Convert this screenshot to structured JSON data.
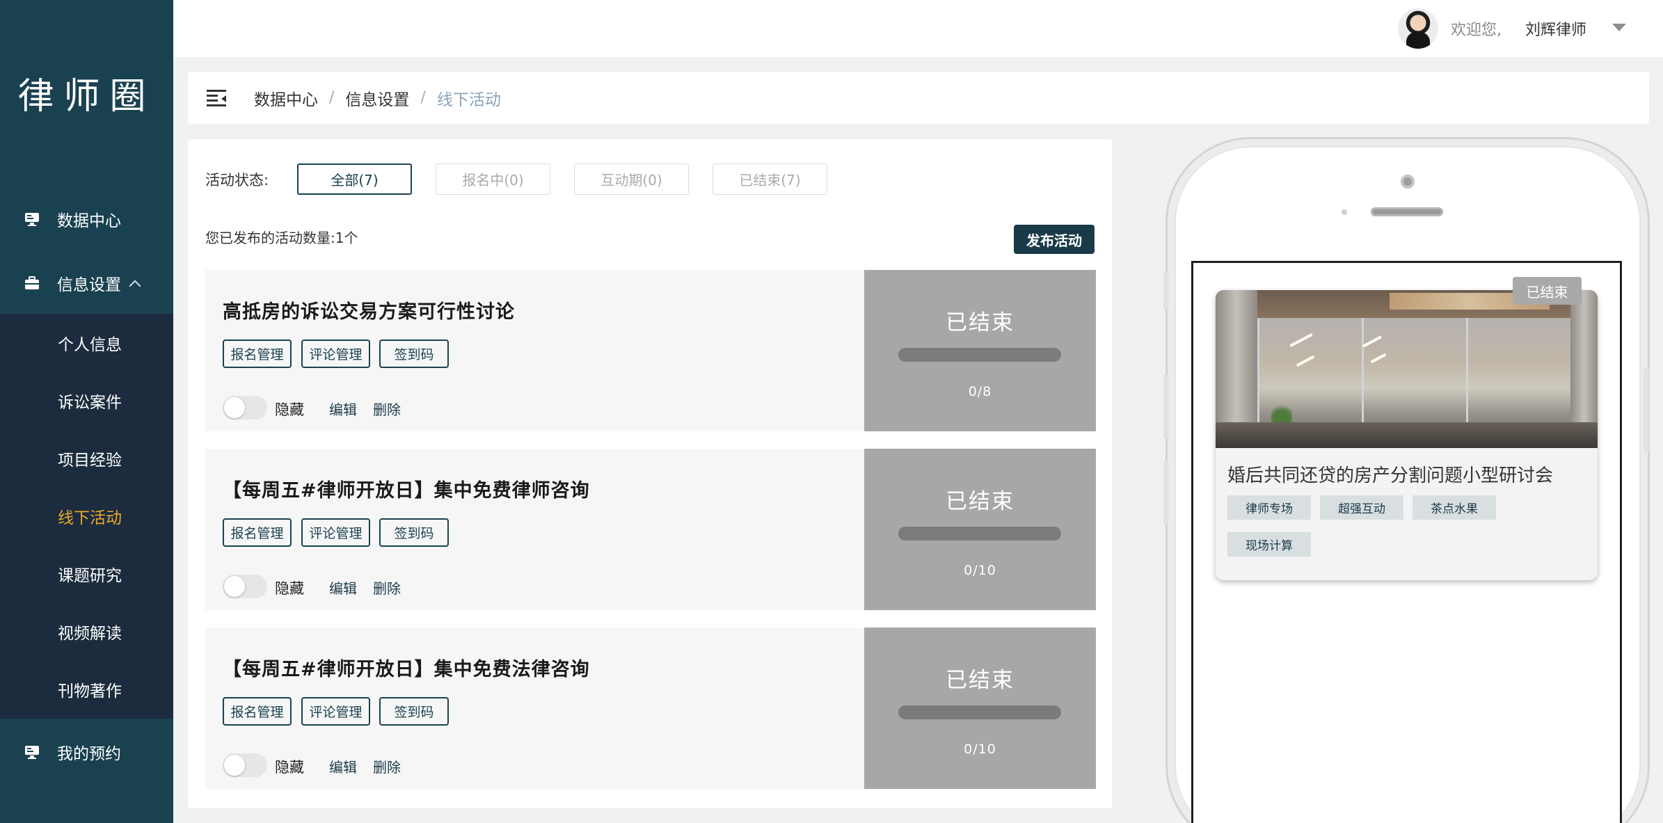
{
  "sidebar": {
    "logo": "律师圈",
    "nav": [
      {
        "label": "数据中心",
        "icon": "monitor-icon"
      },
      {
        "label": "信息设置",
        "icon": "briefcase-icon"
      },
      {
        "label": "我的预约",
        "icon": "monitor-icon"
      }
    ],
    "submenu": [
      "个人信息",
      "诉讼案件",
      "项目经验",
      "线下活动",
      "课题研究",
      "视频解读",
      "刊物著作"
    ],
    "active_sub": "线下活动"
  },
  "header": {
    "welcome": "欢迎您,",
    "username": "刘辉律师"
  },
  "breadcrumb": {
    "items": [
      "数据中心",
      "信息设置",
      "线下活动"
    ],
    "separator": "/"
  },
  "filters": {
    "label": "活动状态:",
    "options": [
      "全部(7)",
      "报名中(0)",
      "互动期(0)",
      "已结束(7)"
    ],
    "active": "全部(7)"
  },
  "summary": {
    "count_text": "您已发布的活动数量:1个",
    "publish_label": "发布活动"
  },
  "card_actions": {
    "signup": "报名管理",
    "comment": "评论管理",
    "checkin": "签到码",
    "hide": "隐藏",
    "edit": "编辑",
    "delete": "删除"
  },
  "activities": [
    {
      "title": "高抵房的诉讼交易方案可行性讨论",
      "status": "已结束",
      "ratio": "0/8",
      "progress": 0
    },
    {
      "title": "【每周五#律师开放日】集中免费律师咨询",
      "status": "已结束",
      "ratio": "0/10",
      "progress": 0
    },
    {
      "title": "【每周五#律师开放日】集中免费法律咨询",
      "status": "已结束",
      "ratio": "0/10",
      "progress": 0
    }
  ],
  "preview": {
    "ended_tag": "已结束",
    "title": "婚后共同还贷的房产分割问题小型研讨会",
    "tags": [
      "律师专场",
      "超强互动",
      "茶点水果",
      "现场计算"
    ]
  },
  "colors": {
    "sidebar": "#1a4150",
    "submenu": "#1c2c3e",
    "accent": "#e8a92c",
    "primary": "#1a3a48",
    "ended": "#a7a7a7"
  }
}
